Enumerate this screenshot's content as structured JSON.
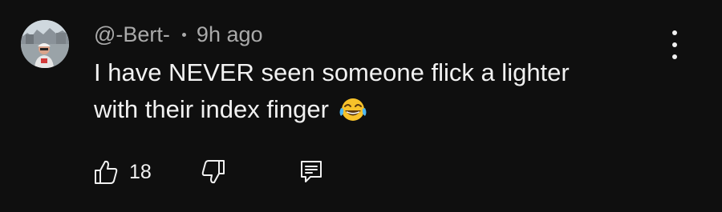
{
  "comment": {
    "author": "@-Bert-",
    "time": "9h ago",
    "text_lines": [
      "I have NEVER seen someone flick a lighter",
      "with their index finger"
    ],
    "emoji": "tears-of-joy-emoji",
    "like_count": "18"
  },
  "icons": {
    "avatar": "avatar",
    "more": "more-vertical-icon",
    "like": "thumbs-up-icon",
    "dislike": "thumbs-down-icon",
    "reply": "reply-icon"
  },
  "colors": {
    "background": "#0f0f0f",
    "primary_text": "#f1f1f1",
    "secondary_text": "#aaaaaa",
    "emoji_face": "#f7c22a"
  }
}
